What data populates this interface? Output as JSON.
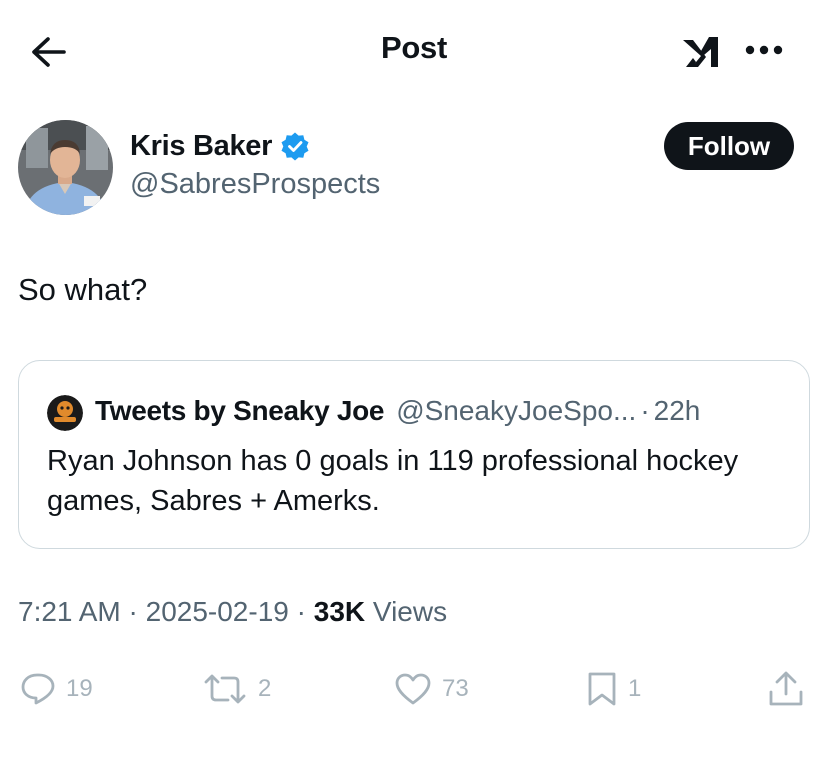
{
  "header": {
    "title": "Post",
    "back_icon": "arrow-left-icon",
    "grok_icon": "grok-icon",
    "more_icon": "more-horizontal-icon"
  },
  "author": {
    "name": "Kris Baker",
    "handle": "@SabresProspects",
    "verified": true
  },
  "follow_label": "Follow",
  "tweet": {
    "text": "So what?"
  },
  "quote": {
    "name": "Tweets by Sneaky Joe",
    "handle": "@SneakyJoeSpo...",
    "separator": "·",
    "time": "22h",
    "text": "Ryan Johnson has 0 goals in 119 professional hockey games, Sabres + Amerks."
  },
  "meta": {
    "time": "7:21 AM",
    "date": "2025-02-19",
    "separator": "·",
    "views_count": "33K",
    "views_label": "Views"
  },
  "actions": {
    "replies": "19",
    "reposts": "2",
    "likes": "73",
    "bookmarks": "1"
  },
  "colors": {
    "text": "#0f1419",
    "secondary": "#536471",
    "verified": "#1d9bf0",
    "border": "#cfd9de",
    "action": "#a7b3bb"
  }
}
